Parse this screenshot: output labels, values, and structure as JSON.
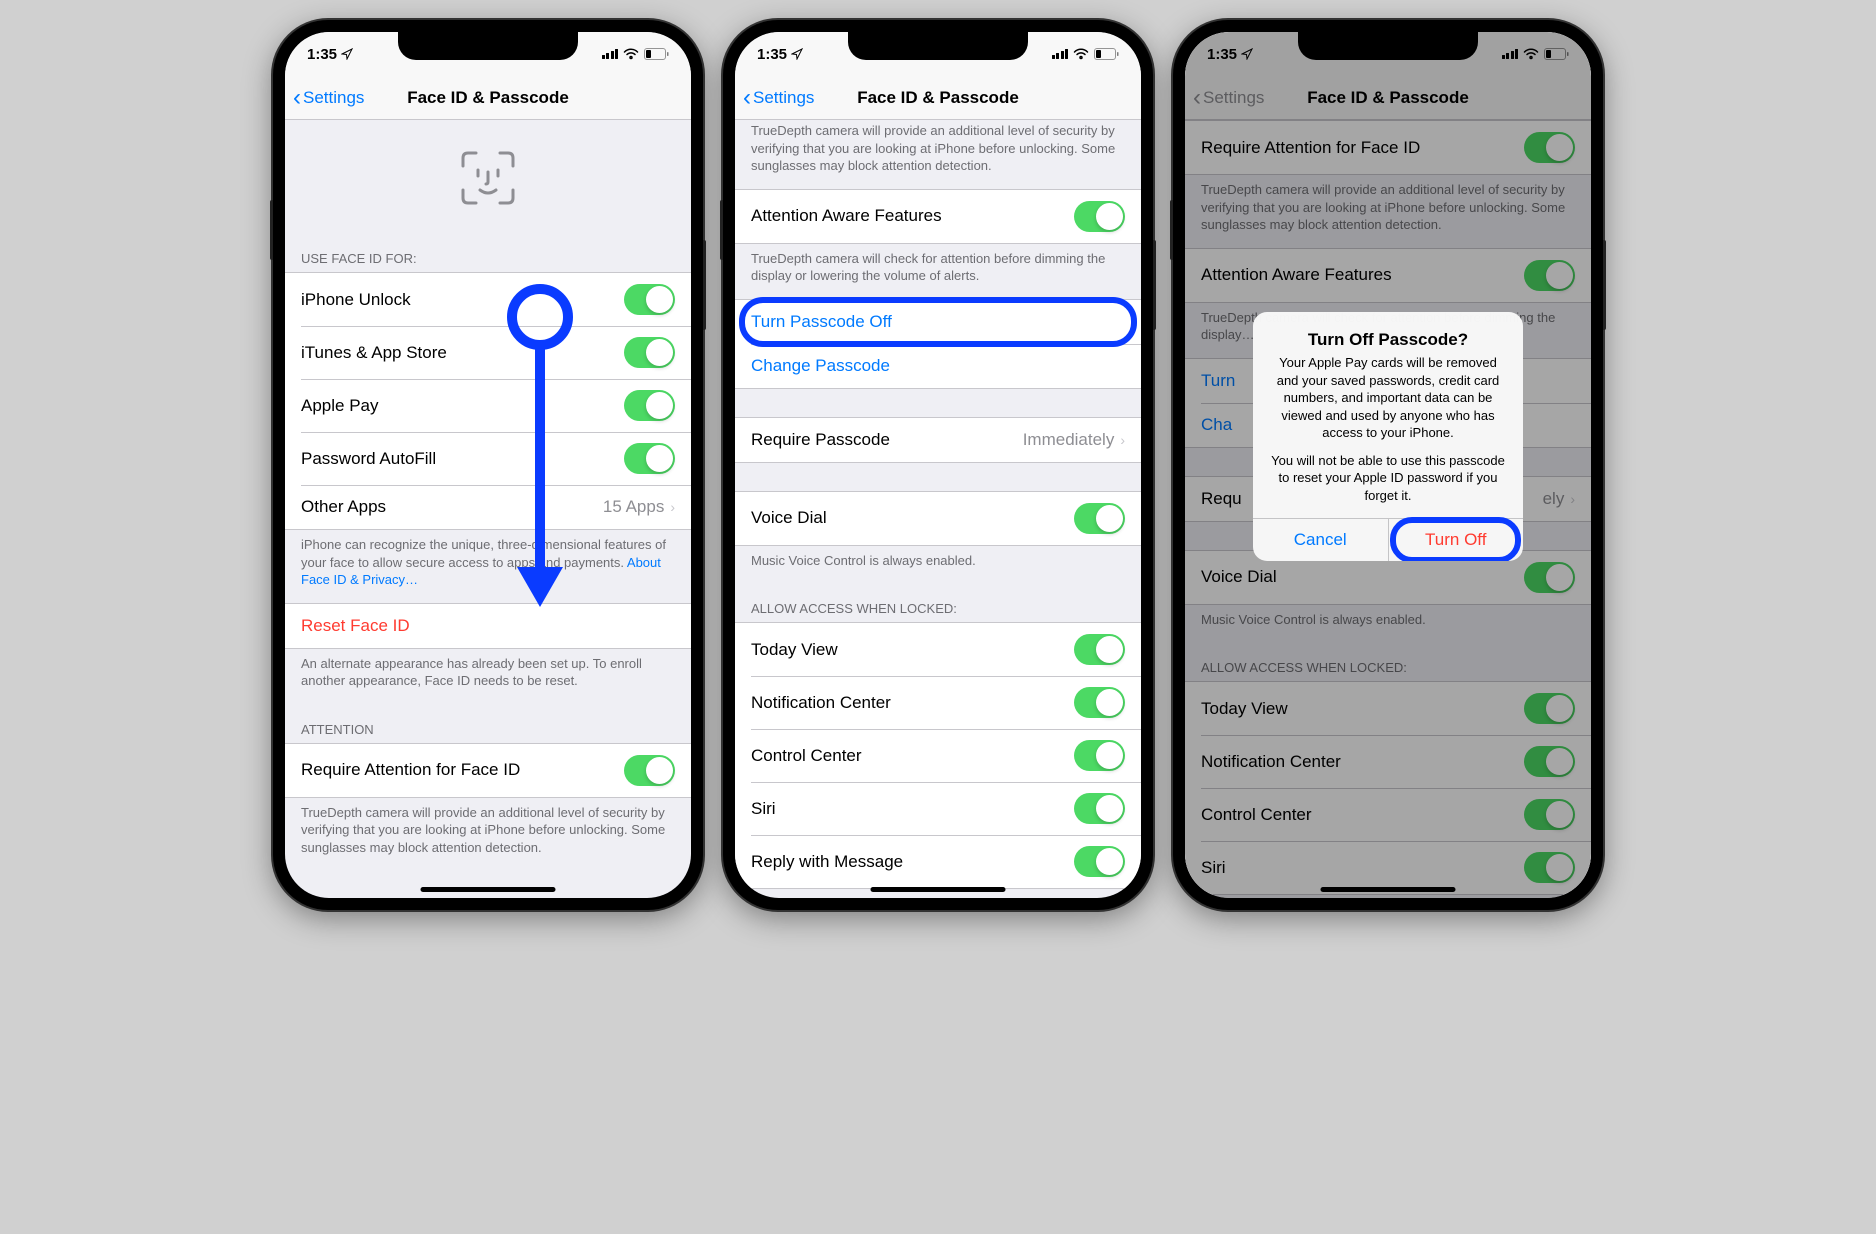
{
  "status": {
    "time": "1:35",
    "location_arrow": "↗"
  },
  "nav": {
    "back": "Settings",
    "title": "Face ID & Passcode"
  },
  "screen1": {
    "section_header": "USE FACE ID FOR:",
    "items": [
      {
        "label": "iPhone Unlock",
        "toggle": true
      },
      {
        "label": "iTunes & App Store",
        "toggle": true
      },
      {
        "label": "Apple Pay",
        "toggle": true
      },
      {
        "label": "Password AutoFill",
        "toggle": true
      }
    ],
    "other_apps": {
      "label": "Other Apps",
      "detail": "15 Apps"
    },
    "footer1": "iPhone can recognize the unique, three-dimensional features of your face to allow secure access to apps and payments. ",
    "footer1_link": "About Face ID & Privacy…",
    "reset": "Reset Face ID",
    "footer2": "An alternate appearance has already been set up. To enroll another appearance, Face ID needs to be reset.",
    "attention_header": "ATTENTION",
    "require_attention": "Require Attention for Face ID",
    "footer3": "TrueDepth camera will provide an additional level of security by verifying that you are looking at iPhone before unlocking. Some sunglasses may block attention detection."
  },
  "screen2": {
    "truncated_footer": "TrueDepth camera will provide an additional level of security by verifying that you are looking at iPhone before unlocking. Some sunglasses may block attention detection.",
    "attention_aware": "Attention Aware Features",
    "attention_aware_footer": "TrueDepth camera will check for attention before dimming the display or lowering the volume of alerts.",
    "turn_off": "Turn Passcode Off",
    "change": "Change Passcode",
    "require": {
      "label": "Require Passcode",
      "detail": "Immediately"
    },
    "voice_dial": "Voice Dial",
    "voice_dial_footer": "Music Voice Control is always enabled.",
    "allow_header": "ALLOW ACCESS WHEN LOCKED:",
    "allow_items": [
      "Today View",
      "Notification Center",
      "Control Center",
      "Siri",
      "Reply with Message"
    ]
  },
  "screen3": {
    "require_attention": "Require Attention for Face ID",
    "footer1": "TrueDepth camera will provide an additional level of security by verifying that you are looking at iPhone before unlocking. Some sunglasses may block attention detection.",
    "attention_aware": "Attention Aware Features",
    "attention_aware_footer": "TrueDepth camera will check for attention before dimming the display…",
    "turn_prefix": "Turn",
    "change_prefix": "Cha",
    "require_prefix": "Requ",
    "require_suffix": "ely",
    "voice_dial": "Voice Dial",
    "voice_dial_footer": "Music Voice Control is always enabled.",
    "allow_header": "ALLOW ACCESS WHEN LOCKED:",
    "allow_items": [
      "Today View",
      "Notification Center",
      "Control Center",
      "Siri"
    ],
    "alert": {
      "title": "Turn Off Passcode?",
      "msg": "Your Apple Pay cards will be removed and your saved passwords, credit card numbers, and important data can be viewed and used by anyone who has access to your iPhone.",
      "msg2": "You will not be able to use this passcode to reset your Apple ID password if you forget it.",
      "cancel": "Cancel",
      "turn_off": "Turn Off"
    }
  }
}
